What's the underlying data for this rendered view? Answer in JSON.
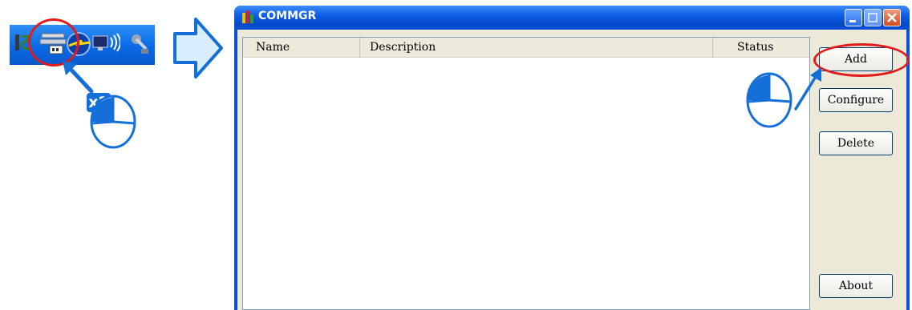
{
  "step_badge": "x2",
  "tray_icons": [
    "is-icon",
    "com-manager-icon",
    "link-icon",
    "network-icon",
    "satellite-icon"
  ],
  "window": {
    "title": "COMMGR",
    "controls": [
      "minimize",
      "maximize",
      "close"
    ]
  },
  "list": {
    "columns": [
      "Name",
      "Description",
      "Status"
    ],
    "rows": []
  },
  "buttons": {
    "add": "Add",
    "configure": "Configure",
    "delete": "Delete",
    "about": "About"
  },
  "colors": {
    "highlight": "#e11b1b",
    "pointer": "#1470d8",
    "titlebar": "#0a50d8"
  }
}
